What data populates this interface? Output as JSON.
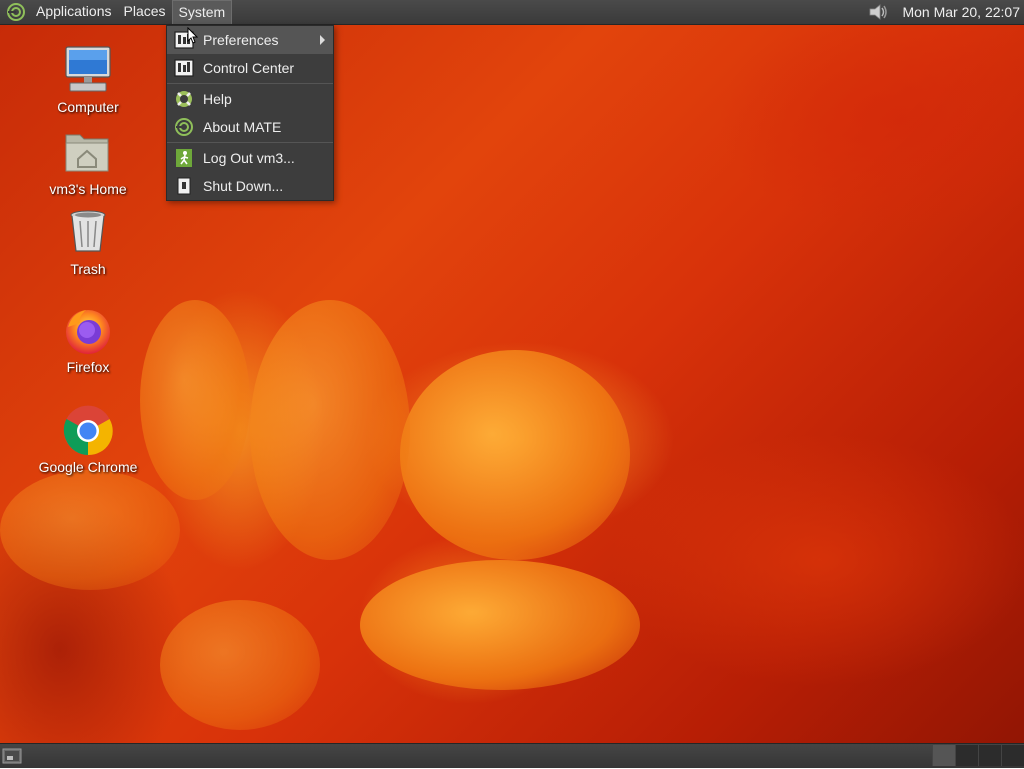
{
  "top_panel": {
    "menus": [
      "Applications",
      "Places",
      "System"
    ],
    "active_menu": "System",
    "clock": "Mon Mar 20, 22:07"
  },
  "system_menu": {
    "items": [
      {
        "label": "Preferences",
        "icon": "preferences-icon",
        "submenu": true
      },
      {
        "label": "Control Center",
        "icon": "control-center-icon"
      },
      {
        "label": "Help",
        "icon": "help-lifebuoy-icon"
      },
      {
        "label": "About MATE",
        "icon": "mate-logo-icon"
      },
      {
        "label": "Log Out vm3...",
        "icon": "logout-icon"
      },
      {
        "label": "Shut Down...",
        "icon": "shutdown-icon"
      }
    ]
  },
  "desktop_icons": [
    {
      "label": "Computer",
      "icon": "computer-icon"
    },
    {
      "label": "vm3's Home",
      "icon": "home-folder-icon"
    },
    {
      "label": "Trash",
      "icon": "trash-icon"
    },
    {
      "label": "Firefox",
      "icon": "firefox-icon"
    },
    {
      "label": "Google Chrome",
      "icon": "chrome-icon"
    }
  ],
  "colors": {
    "panel": "#3a3a3a",
    "menu_bg": "#3d3d3d",
    "wallpaper": "#d8320a"
  }
}
